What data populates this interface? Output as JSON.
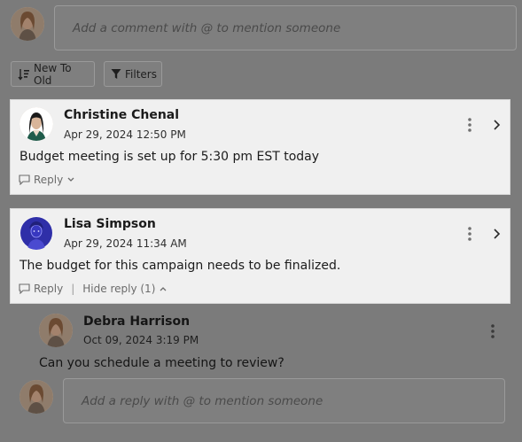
{
  "comment_box": {
    "placeholder": "Add a comment with @ to mention someone",
    "avatar_icon": "user-avatar-icon"
  },
  "toolbar": {
    "sort_label": "New To Old",
    "sort_icon": "sort-descending-icon",
    "filter_label": "Filters",
    "filter_icon": "filter-funnel-icon"
  },
  "comments": [
    {
      "author": "Christine Chenal",
      "date": "Apr 29, 2024 12:50 PM",
      "body": "Budget meeting is set up for 5:30 pm EST today",
      "reply_label": "Reply",
      "avatar_color": "#1f5b4a"
    },
    {
      "author": "Lisa Simpson",
      "date": "Apr 29, 2024 11:34 AM",
      "body": "The budget for this campaign needs to be finalized.",
      "reply_label": "Reply",
      "hide_reply_label": "Hide reply (1)",
      "avatar_color": "#2f2fa8",
      "replies": [
        {
          "author": "Debra Harrison",
          "date": "Oct 09, 2024 3:19 PM",
          "body": "Can you schedule a meeting to review?"
        }
      ]
    }
  ],
  "reply_box": {
    "placeholder": "Add a reply with @ to mention someone"
  },
  "colors": {
    "overlay": "#7b7b7b",
    "card": "#f0f0f0",
    "text": "#1b1b1b",
    "muted": "#6b6b6b"
  }
}
